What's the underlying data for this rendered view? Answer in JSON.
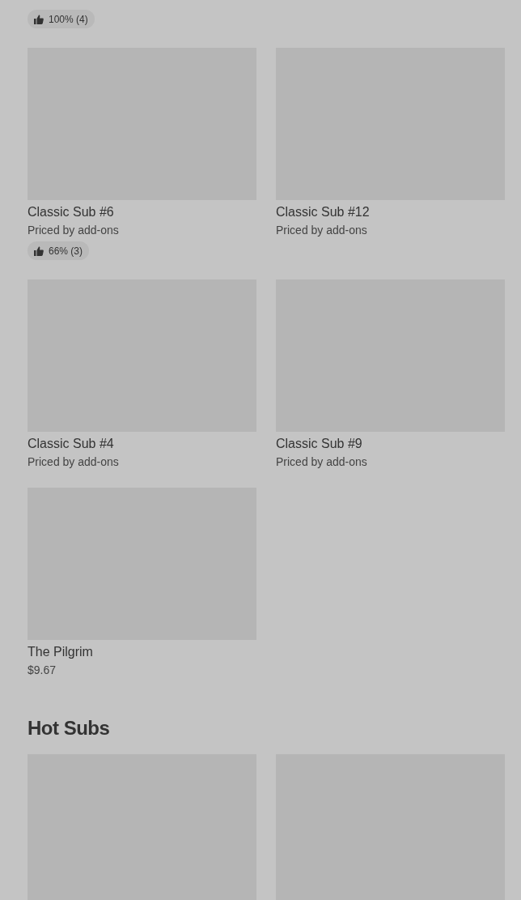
{
  "items": [
    {
      "rating": "100% (4)"
    },
    {
      "name": "Classic Sub #6",
      "description": "Priced by add-ons",
      "rating": "66% (3)"
    },
    {
      "name": "Classic Sub #12",
      "description": "Priced by add-ons"
    },
    {
      "name": "Classic Sub #4",
      "description": "Priced by add-ons"
    },
    {
      "name": "Classic Sub #9",
      "description": "Priced by add-ons"
    },
    {
      "name": "The Pilgrim",
      "description": "$9.67"
    }
  ],
  "sections": [
    {
      "title": "Hot Subs",
      "items": [
        {
          "kind": "placeholder"
        },
        {
          "kind": "placeholder"
        }
      ]
    }
  ]
}
